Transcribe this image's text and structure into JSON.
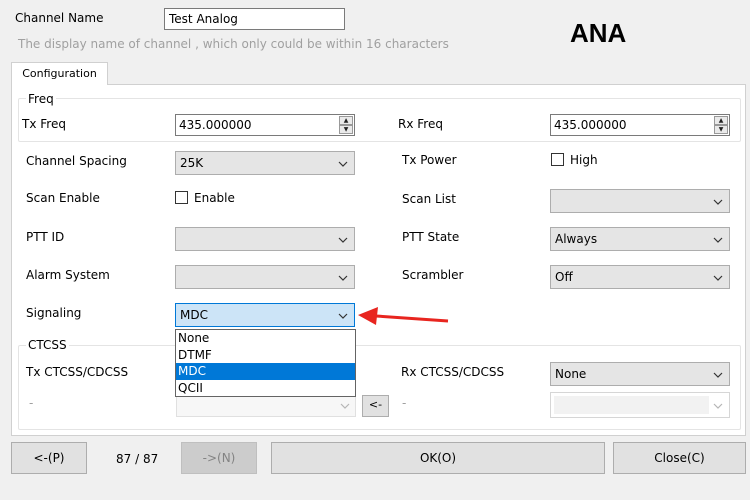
{
  "header": {
    "channel_name_label": "Channel Name",
    "channel_name_value": "Test Analog",
    "hint": "The display name of channel , which only could be within 16 characters",
    "mode_code": "ANA"
  },
  "tabs": [
    {
      "label": "Configuration"
    }
  ],
  "freq": {
    "group_title": "Freq",
    "tx_label": "Tx Freq",
    "tx_value": "435.000000",
    "rx_label": "Rx Freq",
    "rx_value": "435.000000"
  },
  "fields": {
    "channel_spacing_label": "Channel Spacing",
    "channel_spacing_value": "25K",
    "tx_power_label": "Tx Power",
    "tx_power_option": "High",
    "scan_enable_label": "Scan Enable",
    "scan_enable_option": "Enable",
    "scan_list_label": "Scan List",
    "scan_list_value": "",
    "ptt_id_label": "PTT ID",
    "ptt_id_value": "",
    "ptt_state_label": "PTT State",
    "ptt_state_value": "Always",
    "alarm_system_label": "Alarm System",
    "alarm_system_value": "",
    "scrambler_label": "Scrambler",
    "scrambler_value": "Off",
    "signaling_label": "Signaling",
    "signaling_value": "MDC"
  },
  "signaling_dropdown": {
    "options": [
      "None",
      "DTMF",
      "MDC",
      "QCII"
    ],
    "selected": "MDC"
  },
  "ctcss": {
    "group_title": "CTCSS",
    "tx_label": "Tx CTCSS/CDCSS",
    "tx_sub": "-",
    "copy_button": "<-",
    "rx_label": "Rx CTCSS/CDCSS",
    "rx_value": "None",
    "rx_sub": "-"
  },
  "footer": {
    "prev_button": "<-(P)",
    "page_indicator": "87 / 87",
    "next_button": "->(N)",
    "ok_button": "OK(O)",
    "close_button": "Close(C)"
  },
  "colors": {
    "accent": "#0078d7",
    "arrow": "#e8251f",
    "window_bg": "#f0f0f0"
  }
}
